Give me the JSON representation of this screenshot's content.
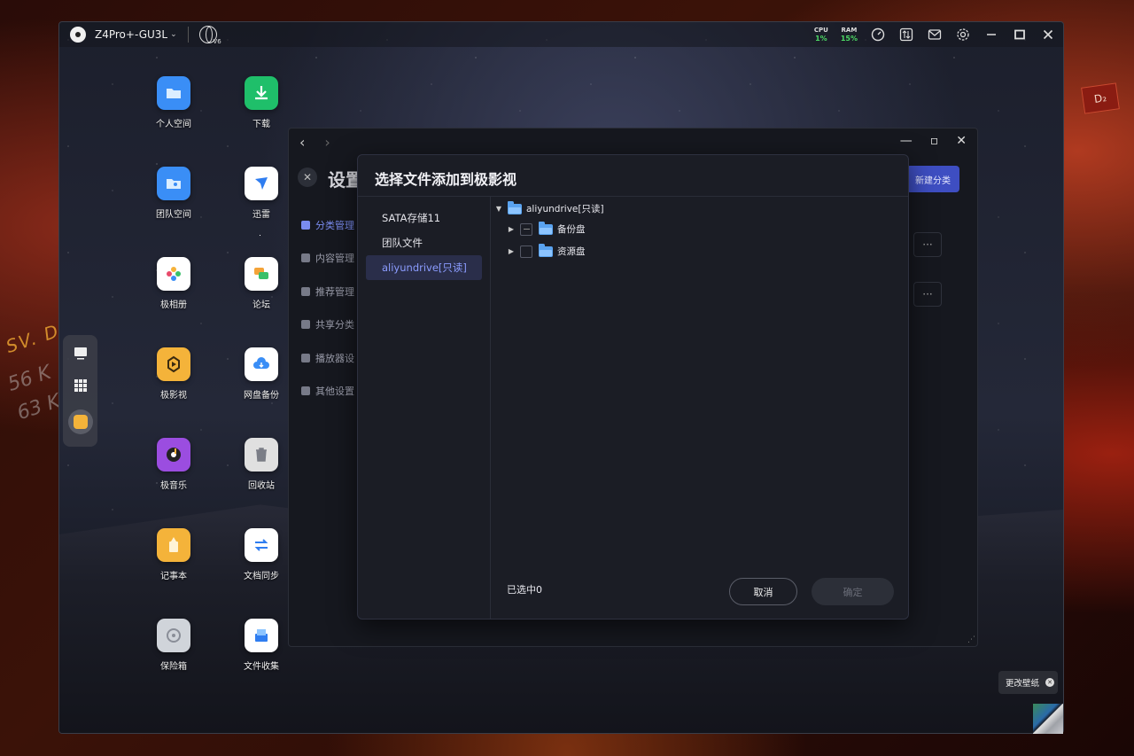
{
  "topbar": {
    "device_name": "Z4Pro+-GU3L",
    "network_badge": "V6",
    "cpu_label": "CPU",
    "cpu_value": "1%",
    "ram_label": "RAM",
    "ram_value": "15%",
    "icons": [
      "gauge-icon",
      "transfer-icon",
      "mail-icon",
      "gear-icon",
      "minimize-icon",
      "maximize-icon",
      "close-icon"
    ]
  },
  "wallpaper": {
    "tag": "D₂",
    "text1": "SV. D",
    "text2": "56 K",
    "text3": "63 K"
  },
  "apps": [
    {
      "name": "个人空间",
      "icon": "folder-icon",
      "color": "#3a8ef6"
    },
    {
      "name": "下载",
      "icon": "download-icon",
      "color": "#1fbf6a"
    },
    {
      "name": "团队空间",
      "icon": "team-folder-icon",
      "color": "#3a8ef6"
    },
    {
      "name": "迅雷",
      "icon": "thunder-icon",
      "color": "#ffffff"
    },
    {
      "name": "极相册",
      "icon": "photos-icon",
      "color": "#ffffff"
    },
    {
      "name": "论坛",
      "icon": "forum-icon",
      "color": "#ffffff"
    },
    {
      "name": "极影视",
      "icon": "video-icon",
      "color": "#f4b33a"
    },
    {
      "name": "网盘备份",
      "icon": "cloud-backup-icon",
      "color": "#ffffff"
    },
    {
      "name": "极音乐",
      "icon": "music-icon",
      "color": "#9b4de0"
    },
    {
      "name": "回收站",
      "icon": "trash-icon",
      "color": "#e0e0e0"
    },
    {
      "name": "记事本",
      "icon": "notepad-icon",
      "color": "#f4b33a"
    },
    {
      "name": "文档同步",
      "icon": "sync-icon",
      "color": "#ffffff"
    },
    {
      "name": "保险箱",
      "icon": "safe-icon",
      "color": "#d0d4da"
    },
    {
      "name": "文件收集",
      "icon": "file-collect-icon",
      "color": "#ffffff"
    }
  ],
  "settings": {
    "title": "设置",
    "new_category": "新建分类",
    "menu": [
      {
        "label": "分类管理",
        "active": true
      },
      {
        "label": "内容管理",
        "active": false
      },
      {
        "label": "推荐管理",
        "active": false
      },
      {
        "label": "共享分类",
        "active": false
      },
      {
        "label": "播放器设",
        "active": false
      },
      {
        "label": "其他设置",
        "active": false
      }
    ],
    "more_label": "···"
  },
  "dialog": {
    "title": "选择文件添加到极影视",
    "sources": [
      {
        "label": "SATA存储11",
        "selected": false
      },
      {
        "label": "团队文件",
        "selected": false
      },
      {
        "label": "aliyundrive[只读]",
        "selected": true
      }
    ],
    "tree": {
      "root": "aliyundrive[只读]",
      "children": [
        "备份盘",
        "资源盘"
      ]
    },
    "selected_count": "已选中0",
    "cancel": "取消",
    "confirm": "确定"
  },
  "wallpaper_tip": "更改壁纸"
}
